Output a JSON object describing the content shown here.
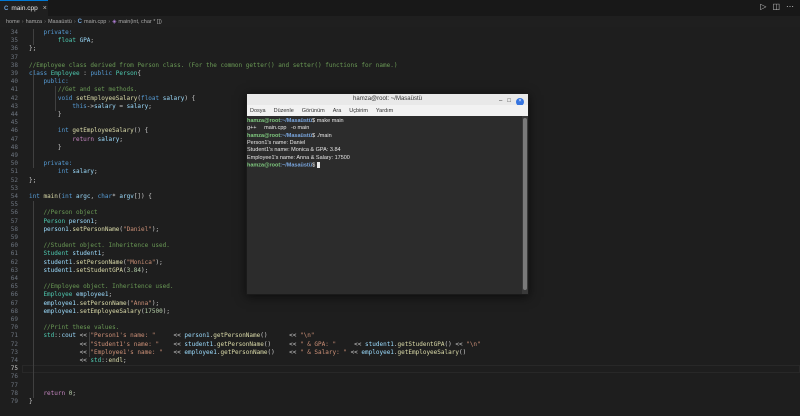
{
  "tab": {
    "label": "main.cpp"
  },
  "breadcrumb": {
    "items": [
      "home",
      "hamza",
      "Masaüstü",
      "main.cpp",
      "main(int, char * [])"
    ]
  },
  "code_lines": [
    {
      "n": 34,
      "t": [
        [
          "kw",
          "    private:"
        ]
      ]
    },
    {
      "n": 35,
      "t": [
        [
          "ty",
          "        float "
        ],
        [
          "vr",
          "GPA"
        ],
        [
          "pu",
          ";"
        ]
      ]
    },
    {
      "n": 36,
      "t": [
        [
          "pu",
          "};"
        ]
      ]
    },
    {
      "n": 37,
      "t": []
    },
    {
      "n": 38,
      "t": [
        [
          "cm",
          "//Employee class derived from Person class. (For the common getter() and setter() functions for name.)"
        ]
      ]
    },
    {
      "n": 39,
      "t": [
        [
          "kw",
          "class "
        ],
        [
          "ty",
          "Employee"
        ],
        [
          "pu",
          " : "
        ],
        [
          "kw",
          "public "
        ],
        [
          "ty",
          "Person"
        ],
        [
          "pu",
          "{"
        ]
      ]
    },
    {
      "n": 40,
      "t": [
        [
          "kw",
          "    public:"
        ]
      ]
    },
    {
      "n": 41,
      "t": [
        [
          "cm",
          "        //Get and set methods."
        ]
      ]
    },
    {
      "n": 42,
      "t": [
        [
          "kw",
          "        void "
        ],
        [
          "fn",
          "setEmployeeSalary"
        ],
        [
          "pu",
          "("
        ],
        [
          "kw",
          "float "
        ],
        [
          "vr",
          "salary"
        ],
        [
          "pu",
          ") {"
        ]
      ]
    },
    {
      "n": 43,
      "t": [
        [
          "kw",
          "            this"
        ],
        [
          "pu",
          "->"
        ],
        [
          "vr",
          "salary"
        ],
        [
          "pu",
          " = "
        ],
        [
          "vr",
          "salary"
        ],
        [
          "pu",
          ";"
        ]
      ]
    },
    {
      "n": 44,
      "t": [
        [
          "pu",
          "        }"
        ]
      ]
    },
    {
      "n": 45,
      "t": []
    },
    {
      "n": 46,
      "t": [
        [
          "kw",
          "        int "
        ],
        [
          "fn",
          "getEmployeeSalary"
        ],
        [
          "pu",
          "() {"
        ]
      ]
    },
    {
      "n": 47,
      "t": [
        [
          "ctl",
          "            return "
        ],
        [
          "vr",
          "salary"
        ],
        [
          "pu",
          ";"
        ]
      ]
    },
    {
      "n": 48,
      "t": [
        [
          "pu",
          "        }"
        ]
      ]
    },
    {
      "n": 49,
      "t": []
    },
    {
      "n": 50,
      "t": [
        [
          "kw",
          "    private:"
        ]
      ]
    },
    {
      "n": 51,
      "t": [
        [
          "kw",
          "        int "
        ],
        [
          "vr",
          "salary"
        ],
        [
          "pu",
          ";"
        ]
      ]
    },
    {
      "n": 52,
      "t": [
        [
          "pu",
          "};"
        ]
      ]
    },
    {
      "n": 53,
      "t": []
    },
    {
      "n": 54,
      "t": [
        [
          "kw",
          "int "
        ],
        [
          "fn",
          "main"
        ],
        [
          "pu",
          "("
        ],
        [
          "kw",
          "int "
        ],
        [
          "vr",
          "argc"
        ],
        [
          "pu",
          ", "
        ],
        [
          "kw",
          "char"
        ],
        [
          "pu",
          "* "
        ],
        [
          "vr",
          "argv"
        ],
        [
          "pu",
          "[]) {"
        ]
      ]
    },
    {
      "n": 55,
      "t": []
    },
    {
      "n": 56,
      "t": [
        [
          "cm",
          "    //Person object"
        ]
      ]
    },
    {
      "n": 57,
      "t": [
        [
          "ty",
          "    Person "
        ],
        [
          "vr",
          "person1"
        ],
        [
          "pu",
          ";"
        ]
      ]
    },
    {
      "n": 58,
      "t": [
        [
          "vr",
          "    person1"
        ],
        [
          "pu",
          "."
        ],
        [
          "fn",
          "setPersonName"
        ],
        [
          "pu",
          "("
        ],
        [
          "st",
          "\"Daniel\""
        ],
        [
          "pu",
          ");"
        ]
      ]
    },
    {
      "n": 59,
      "t": []
    },
    {
      "n": 60,
      "t": [
        [
          "cm",
          "    //Student object. Inheritence used."
        ]
      ]
    },
    {
      "n": 61,
      "t": [
        [
          "ty",
          "    Student "
        ],
        [
          "vr",
          "student1"
        ],
        [
          "pu",
          ";"
        ]
      ]
    },
    {
      "n": 62,
      "t": [
        [
          "vr",
          "    student1"
        ],
        [
          "pu",
          "."
        ],
        [
          "fn",
          "setPersonName"
        ],
        [
          "pu",
          "("
        ],
        [
          "st",
          "\"Monica\""
        ],
        [
          "pu",
          ");"
        ]
      ]
    },
    {
      "n": 63,
      "t": [
        [
          "vr",
          "    student1"
        ],
        [
          "pu",
          "."
        ],
        [
          "fn",
          "setStudentGPA"
        ],
        [
          "pu",
          "("
        ],
        [
          "nm",
          "3.84"
        ],
        [
          "pu",
          ");"
        ]
      ]
    },
    {
      "n": 64,
      "t": []
    },
    {
      "n": 65,
      "t": [
        [
          "cm",
          "    //Employee object. Inheritence used."
        ]
      ]
    },
    {
      "n": 66,
      "t": [
        [
          "ty",
          "    Employee "
        ],
        [
          "vr",
          "employee1"
        ],
        [
          "pu",
          ";"
        ]
      ]
    },
    {
      "n": 67,
      "t": [
        [
          "vr",
          "    employee1"
        ],
        [
          "pu",
          "."
        ],
        [
          "fn",
          "setPersonName"
        ],
        [
          "pu",
          "("
        ],
        [
          "st",
          "\"Anna\""
        ],
        [
          "pu",
          ");"
        ]
      ]
    },
    {
      "n": 68,
      "t": [
        [
          "vr",
          "    employee1"
        ],
        [
          "pu",
          "."
        ],
        [
          "fn",
          "setEmployeeSalary"
        ],
        [
          "pu",
          "("
        ],
        [
          "nm",
          "17500"
        ],
        [
          "pu",
          ");"
        ]
      ]
    },
    {
      "n": 69,
      "t": []
    },
    {
      "n": 70,
      "t": [
        [
          "cm",
          "    //Print these values."
        ]
      ]
    },
    {
      "n": 71,
      "t": [
        [
          "ty",
          "    std"
        ],
        [
          "pu",
          "::"
        ],
        [
          "vr",
          "cout"
        ],
        [
          "pu",
          " << "
        ],
        [
          "st",
          "\"Person1's name: \""
        ],
        [
          "pu",
          "     << "
        ],
        [
          "vr",
          "person1"
        ],
        [
          "pu",
          "."
        ],
        [
          "fn",
          "getPersonName"
        ],
        [
          "pu",
          "()      << "
        ],
        [
          "st",
          "\"\\n\""
        ]
      ]
    },
    {
      "n": 72,
      "t": [
        [
          "pu",
          "              << "
        ],
        [
          "st",
          "\"Student1's name: \""
        ],
        [
          "pu",
          "    << "
        ],
        [
          "vr",
          "student1"
        ],
        [
          "pu",
          "."
        ],
        [
          "fn",
          "getPersonName"
        ],
        [
          "pu",
          "()     << "
        ],
        [
          "st",
          "\" & GPA: \""
        ],
        [
          "pu",
          "     << "
        ],
        [
          "vr",
          "student1"
        ],
        [
          "pu",
          "."
        ],
        [
          "fn",
          "getStudentGPA"
        ],
        [
          "pu",
          "() << "
        ],
        [
          "st",
          "\"\\n\""
        ]
      ]
    },
    {
      "n": 73,
      "t": [
        [
          "pu",
          "              << "
        ],
        [
          "st",
          "\"Employee1's name: \""
        ],
        [
          "pu",
          "   << "
        ],
        [
          "vr",
          "employee1"
        ],
        [
          "pu",
          "."
        ],
        [
          "fn",
          "getPersonName"
        ],
        [
          "pu",
          "()    << "
        ],
        [
          "st",
          "\" & Salary: \""
        ],
        [
          "pu",
          " << "
        ],
        [
          "vr",
          "employee1"
        ],
        [
          "pu",
          "."
        ],
        [
          "fn",
          "getEmployeeSalary"
        ],
        [
          "pu",
          "()"
        ]
      ]
    },
    {
      "n": 74,
      "t": [
        [
          "pu",
          "              << "
        ],
        [
          "ty",
          "std"
        ],
        [
          "pu",
          "::"
        ],
        [
          "fn",
          "endl"
        ],
        [
          "pu",
          ";"
        ]
      ]
    },
    {
      "n": 75,
      "t": []
    },
    {
      "n": 76,
      "t": []
    },
    {
      "n": 77,
      "t": []
    },
    {
      "n": 78,
      "t": [
        [
          "ctl",
          "    return "
        ],
        [
          "nm",
          "0"
        ],
        [
          "pu",
          ";"
        ]
      ]
    },
    {
      "n": 79,
      "t": [
        [
          "pu",
          "}"
        ]
      ]
    }
  ],
  "active_line": 75,
  "terminal": {
    "title": "hamza@root: ~/Masaüstü",
    "menu": [
      "Dosya",
      "Düzenle",
      "Görünüm",
      "Ara",
      "Uçbirim",
      "Yardım"
    ],
    "prompt_user": "hamza@root",
    "prompt_path": ":~/Masaüstü",
    "lines": [
      {
        "prompt": true,
        "cmd": "$ make main"
      },
      {
        "prompt": false,
        "text": "g++     main.cpp   -o main"
      },
      {
        "prompt": true,
        "cmd": "$ ./main"
      },
      {
        "prompt": false,
        "text": "Person1's name: Daniel"
      },
      {
        "prompt": false,
        "text": "Student1's name: Monica & GPA: 3.84"
      },
      {
        "prompt": false,
        "text": "Employee1's name: Anna & Salary: 17500"
      },
      {
        "prompt": true,
        "cmd": "$ ",
        "cursor": true
      }
    ]
  }
}
